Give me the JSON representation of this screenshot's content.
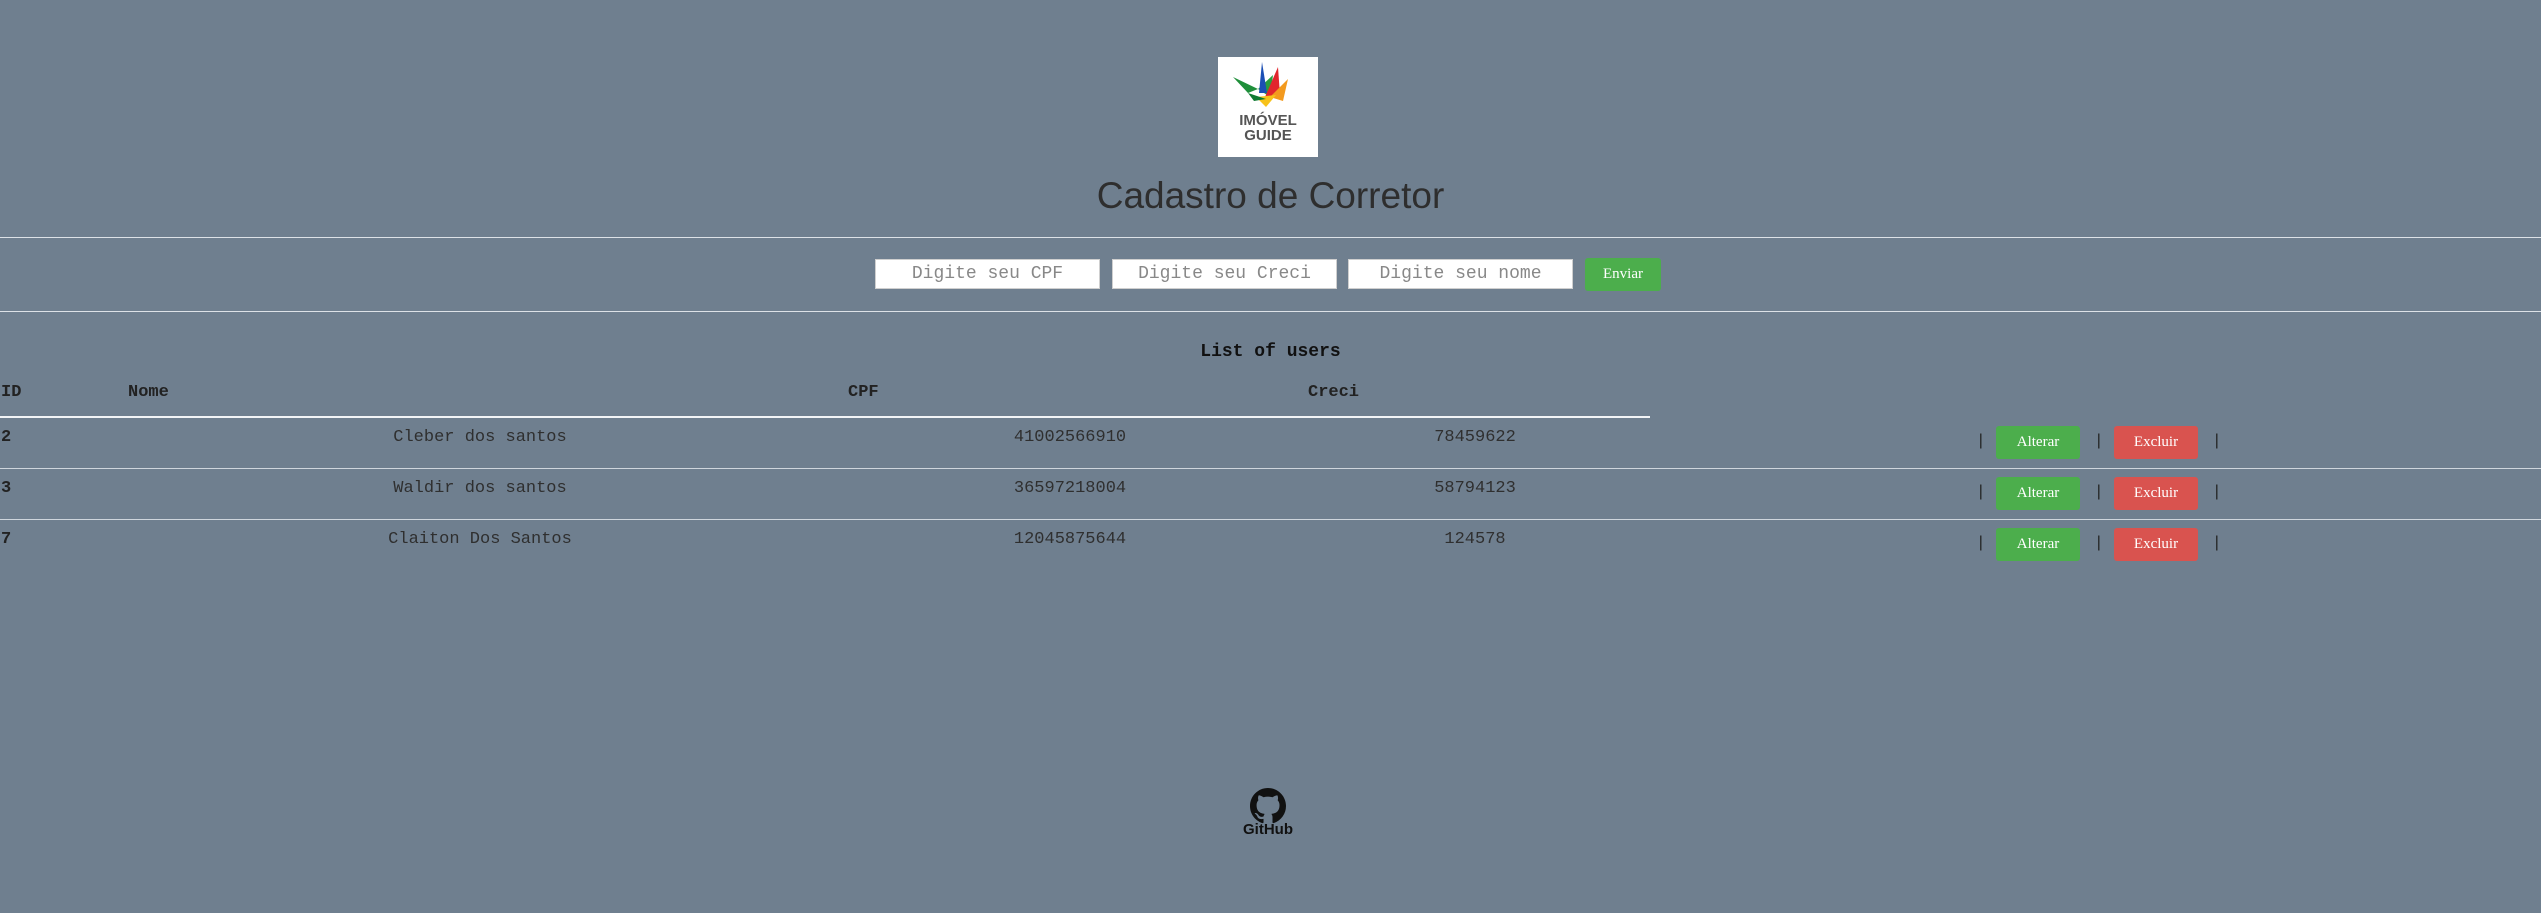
{
  "logo": {
    "line1": "IMÓVEL",
    "line2": "GUIDE"
  },
  "title": "Cadastro de Corretor",
  "form": {
    "cpf_placeholder": "Digite seu CPF",
    "creci_placeholder": "Digite seu Creci",
    "nome_placeholder": "Digite seu nome",
    "submit_label": "Enviar"
  },
  "list": {
    "title": "List of users",
    "headers": {
      "id": "ID",
      "nome": "Nome",
      "cpf": "CPF",
      "creci": "Creci"
    },
    "rows": [
      {
        "id": "2",
        "nome": "Cleber dos santos",
        "cpf": "41002566910",
        "creci": "78459622"
      },
      {
        "id": "3",
        "nome": "Waldir dos santos",
        "cpf": "36597218004",
        "creci": "58794123"
      },
      {
        "id": "7",
        "nome": "Claiton Dos Santos",
        "cpf": "12045875644",
        "creci": "124578"
      }
    ],
    "separator": "|",
    "edit_label": "Alterar",
    "delete_label": "Excluir"
  },
  "footer": {
    "github_label": "GitHub",
    "icon": "github-icon"
  },
  "colors": {
    "background": "#6f7f8f",
    "success": "#4cae4c",
    "danger": "#d9534f"
  }
}
